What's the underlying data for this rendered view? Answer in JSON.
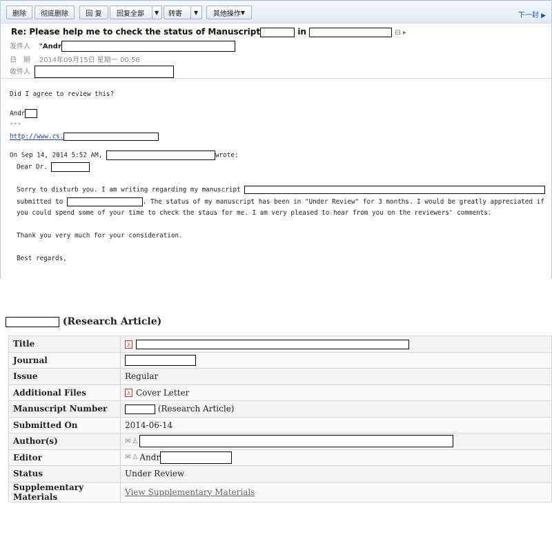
{
  "toolbar": {
    "delete": "删除",
    "delete_permanently": "彻底删除",
    "reply": "回 复",
    "reply_all": "回复全部",
    "forward": "转寄",
    "more_actions": "其他操作",
    "next": "下一封"
  },
  "email": {
    "subject_prefix": "Re: Please help me to check the status of Manuscript",
    "subject_in": "in",
    "from_label": "发件人",
    "from_value": "\"Andr",
    "date_label": "日　期",
    "date_value": "2014年09月15日 星期一 00:56",
    "to_label": "收件人",
    "lines": {
      "l1": "Did I agree to review this?",
      "sig_name": "Andr",
      "dashes": "---",
      "url": "http://www.cs.",
      "on_prefix": "On Sep 14, 2014 5:52 AM,",
      "on_suffix": "wrote:",
      "dear": "Dear Dr.",
      "p1a": "Sorry to disturb you. I am writing regarding my manuscript",
      "p1b_pre": "submitted to",
      "p1b_post": ". The status of my manuscript has been in \"Under Review\" for 3 months. I would be greatly appreciated if",
      "p1c": "you could spend some of your time to check the staus for me. I am very pleased to hear from you on the reviewers' comments.",
      "thanks": "Thank you very much for your consideration.",
      "regards": "Best regards,"
    }
  },
  "manuscript": {
    "heading_suffix": "(Research Article)",
    "rows": {
      "title": "Title",
      "journal": "Journal",
      "issue_label": "Issue",
      "issue_value": "Regular",
      "files_label": "Additional Files",
      "files_value": "Cover Letter",
      "number_label": "Manuscript Number",
      "number_value": "(Research Article)",
      "submitted_label": "Submitted On",
      "submitted_value": "2014-06-14",
      "authors_label": "Author(s)",
      "editor_label": "Editor",
      "editor_value": "Andr",
      "status_label": "Status",
      "status_value": "Under Review",
      "supp_label": "Supplementary Materials",
      "supp_value": "View Supplementary Materials"
    }
  }
}
